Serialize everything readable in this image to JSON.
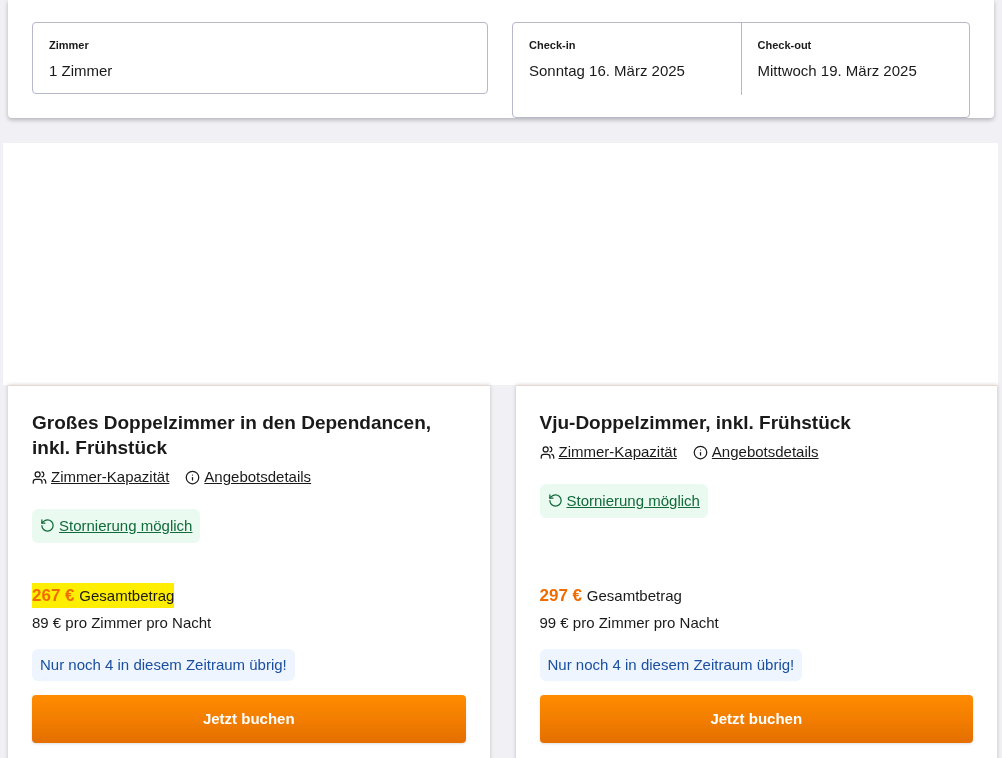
{
  "search": {
    "rooms": {
      "label": "Zimmer",
      "value": "1 Zimmer"
    },
    "checkin": {
      "label": "Check-in",
      "value": "Sonntag 16. März 2025"
    },
    "checkout": {
      "label": "Check-out",
      "value": "Mittwoch 19. März 2025"
    }
  },
  "offers": [
    {
      "title": "Großes Doppelzimmer in den Dependancen, inkl. Frühstück",
      "capacity_link": "Zimmer-Kapazität",
      "details_link": "Angebotsdetails",
      "cancellation": "Stornierung möglich",
      "total": "267 €",
      "total_label": "Gesamtbetrag",
      "highlighted": true,
      "per_night": "89 € pro Zimmer pro Nacht",
      "availability": "Nur noch 4 in diesem Zeitraum übrig!",
      "button": "Jetzt buchen"
    },
    {
      "title": "Vju-Doppelzimmer, inkl. Frühstück",
      "capacity_link": "Zimmer-Kapazität",
      "details_link": "Angebotsdetails",
      "cancellation": "Stornierung möglich",
      "total": "297 €",
      "total_label": "Gesamtbetrag",
      "highlighted": false,
      "per_night": "99 € pro Zimmer pro Nacht",
      "availability": "Nur noch 4 in diesem Zeitraum übrig!",
      "button": "Jetzt buchen"
    }
  ]
}
